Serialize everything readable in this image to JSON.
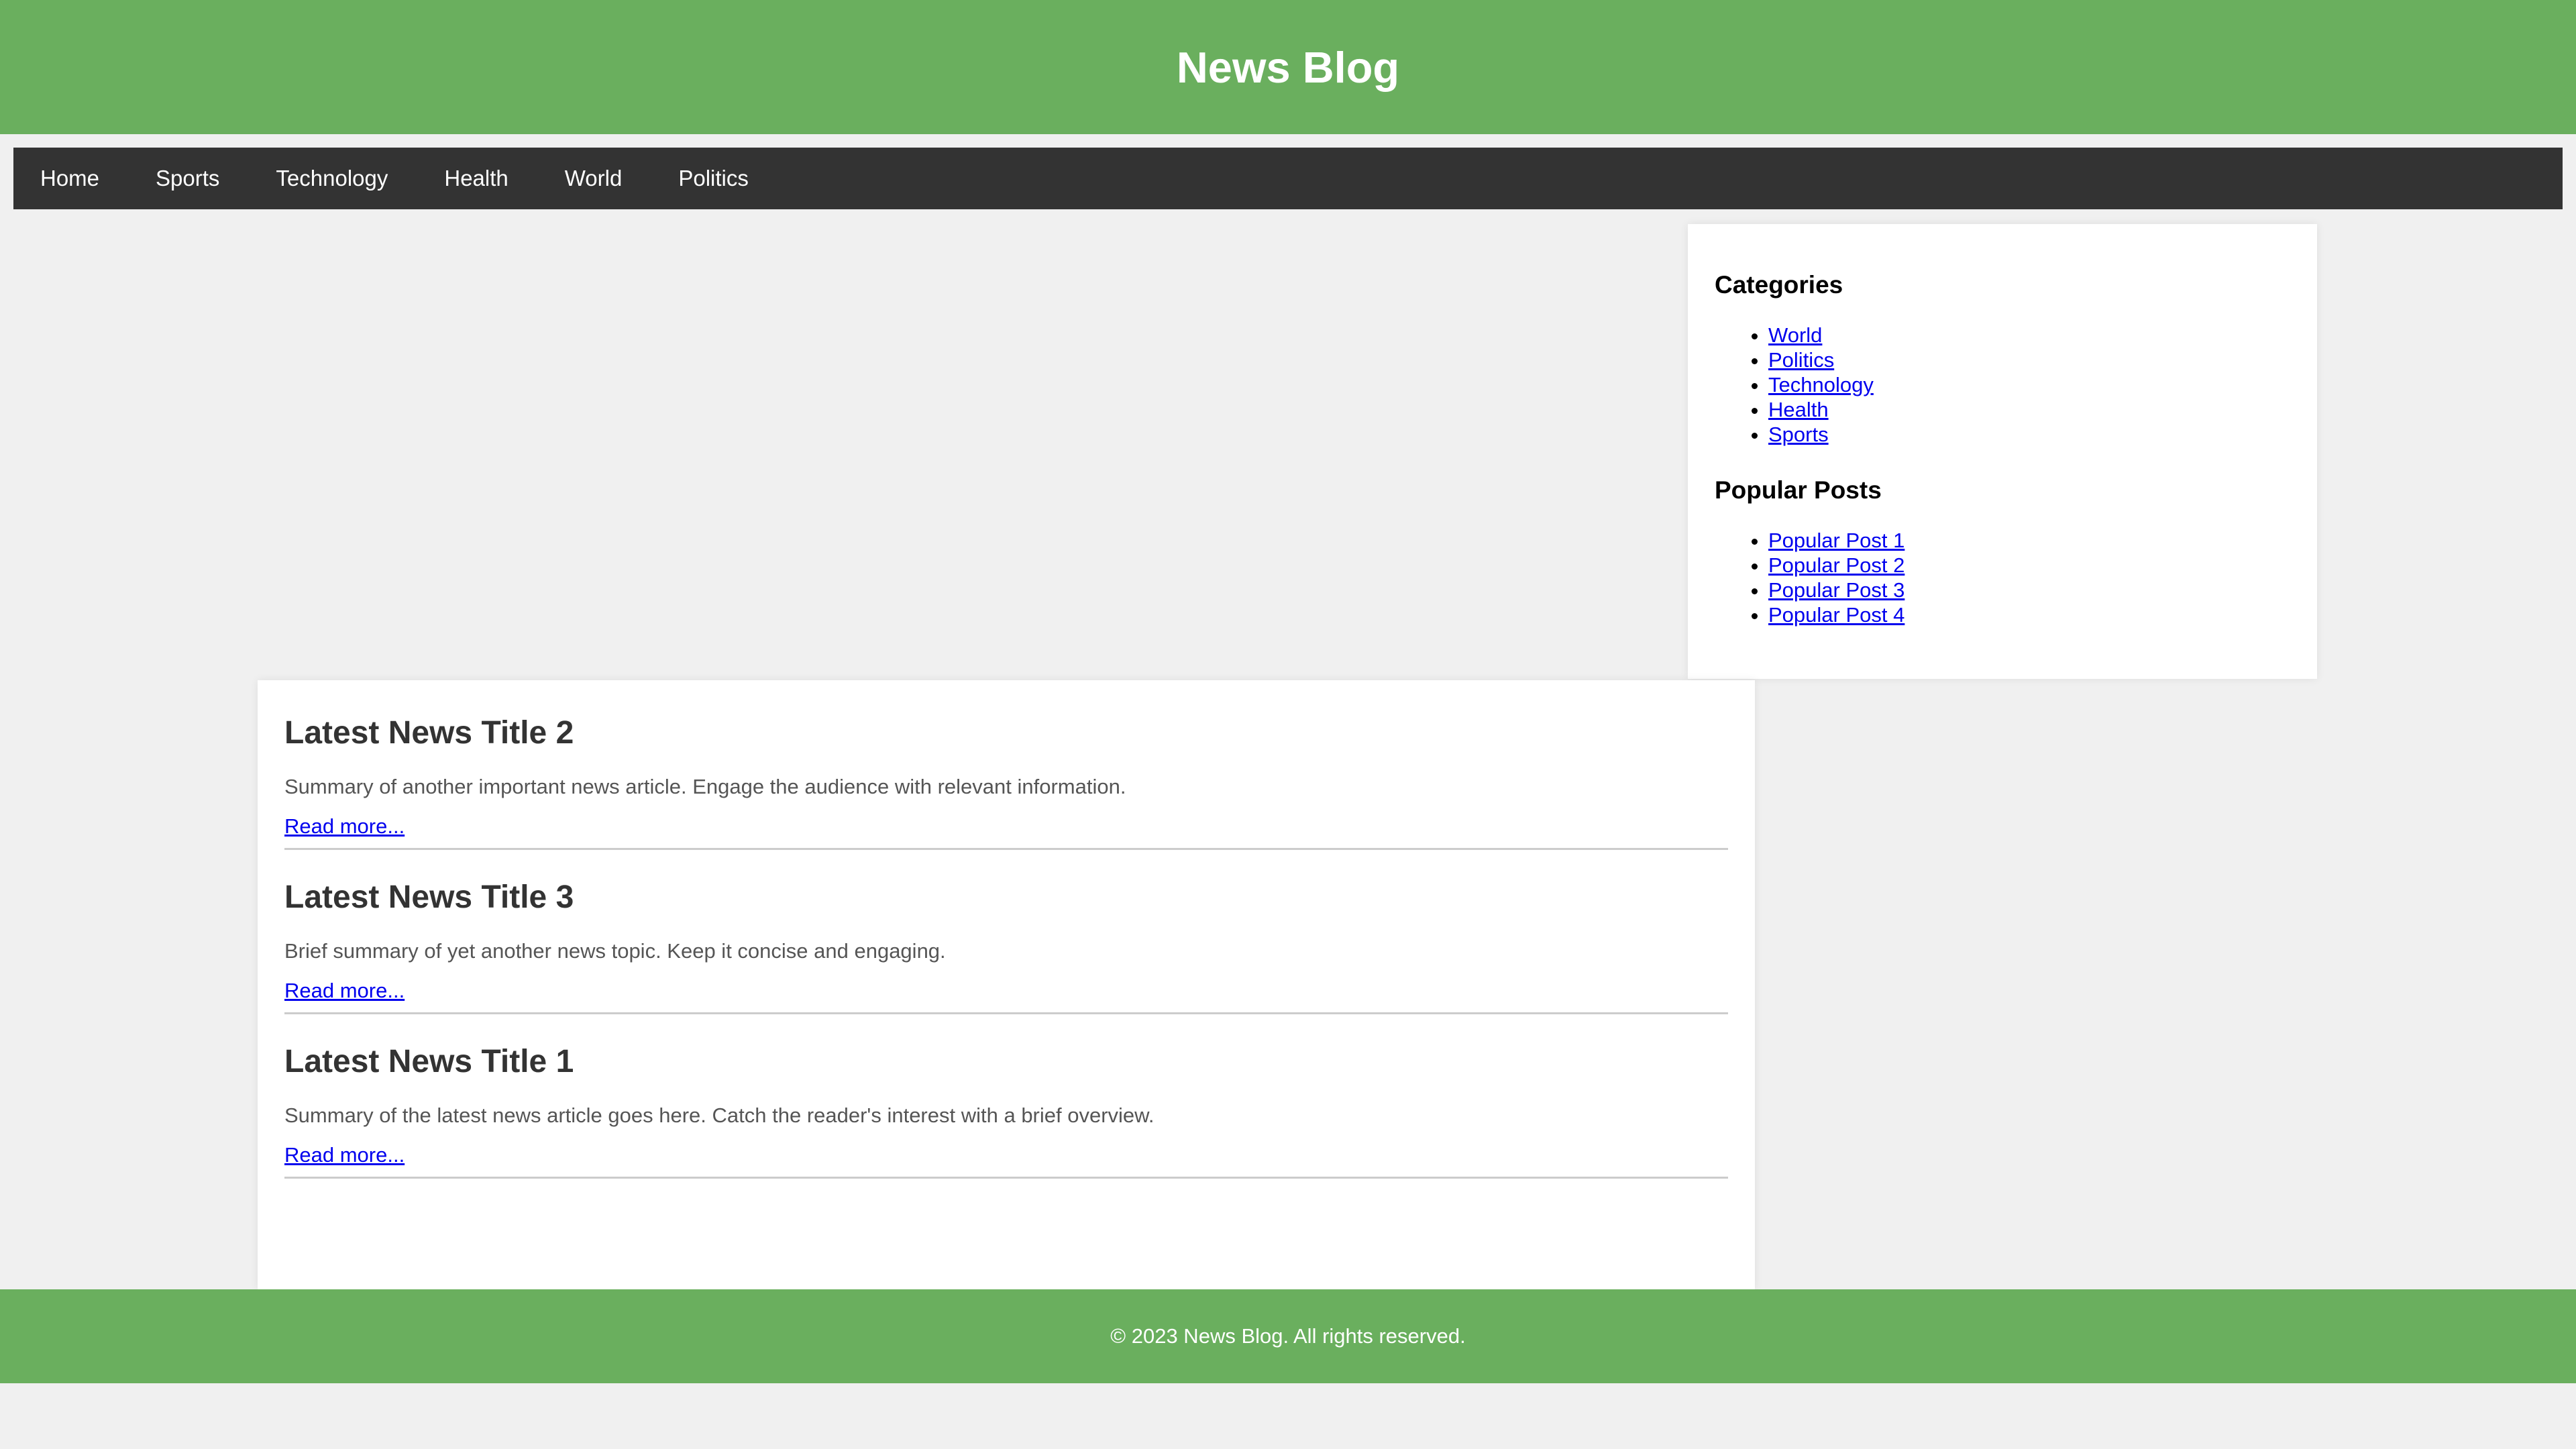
{
  "header": {
    "title": "News Blog"
  },
  "nav": {
    "items": [
      {
        "label": "Home"
      },
      {
        "label": "Sports"
      },
      {
        "label": "Technology"
      },
      {
        "label": "Health"
      },
      {
        "label": "World"
      },
      {
        "label": "Politics"
      }
    ]
  },
  "sidebar": {
    "categories_heading": "Categories",
    "categories": [
      {
        "label": "World"
      },
      {
        "label": "Politics"
      },
      {
        "label": "Technology"
      },
      {
        "label": "Health"
      },
      {
        "label": "Sports"
      }
    ],
    "popular_heading": "Popular Posts",
    "popular": [
      {
        "label": "Popular Post 1"
      },
      {
        "label": "Popular Post 2"
      },
      {
        "label": "Popular Post 3"
      },
      {
        "label": "Popular Post 4"
      }
    ]
  },
  "articles": [
    {
      "title": "Latest News Title 2",
      "summary": "Summary of another important news article. Engage the audience with relevant information.",
      "link_label": "Read more..."
    },
    {
      "title": "Latest News Title 3",
      "summary": "Brief summary of yet another news topic. Keep it concise and engaging.",
      "link_label": "Read more..."
    },
    {
      "title": "Latest News Title 1",
      "summary": "Summary of the latest news article goes here. Catch the reader's interest with a brief overview.",
      "link_label": "Read more..."
    }
  ],
  "footer": {
    "text": "© 2023 News Blog. All rights reserved."
  },
  "colors": {
    "header_bg": "#6aaf5e",
    "nav_bg": "#333333",
    "page_bg": "#f0f0f0",
    "link": "#0000ee"
  }
}
